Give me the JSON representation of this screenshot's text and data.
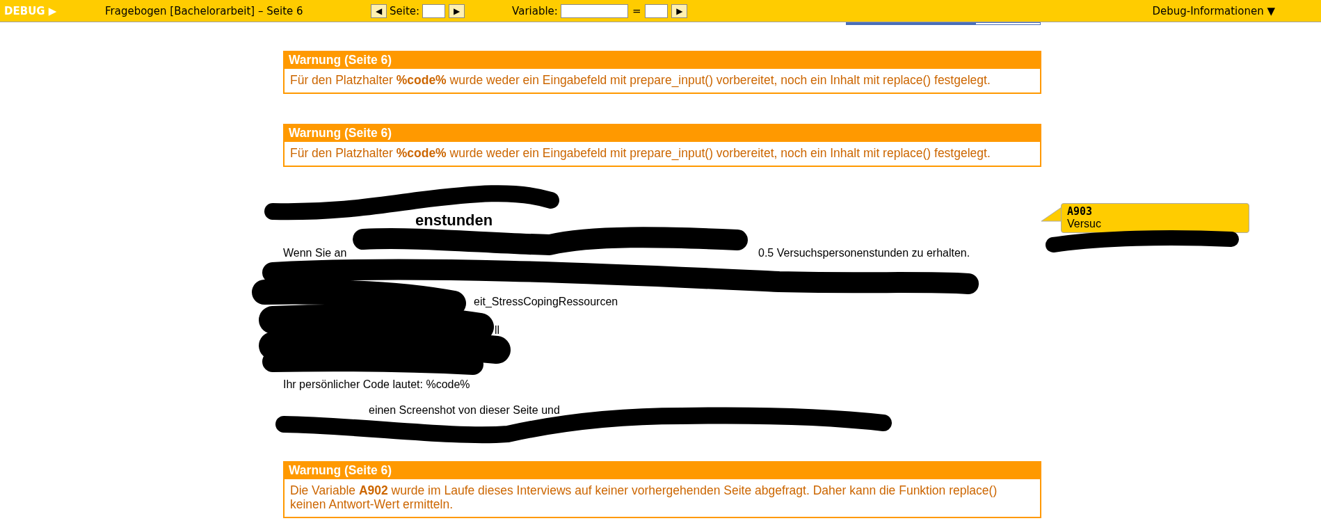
{
  "toolbar": {
    "debug_label": "DEBUG ▶",
    "title": "Fragebogen [Bachelorarbeit] – Seite 6",
    "prev_button": "◀",
    "page_label": "Seite:",
    "next_button": "▶",
    "variable_label": "Variable:",
    "equals": "=",
    "variable_go_button": "▶",
    "info_menu": "Debug-Informationen ▼"
  },
  "progress": {
    "level": 0.67
  },
  "warnings": [
    {
      "title": "Warnung (Seite 6)",
      "message": "Für den Platzhalter **%code%** wurde weder ein Eingabefeld mit prepare_input() vorbereitet, noch ein Inhalt mit replace() festgelegt."
    },
    {
      "title": "Warnung (Seite 6)",
      "message": "Für den Platzhalter **%code%** wurde weder ein Eingabefeld mit prepare_input() vorbereitet, noch ein Inhalt mit replace() festgelegt."
    }
  ],
  "content": {
    "heading": "enstunden",
    "lines": [
      [
        "Wenn Sie an",
        "0.5 Versuchspersonenstunden zu erhalten."
      ],
      [
        "eit_StressCopingRessourcen"
      ],
      [
        "ll"
      ],
      [
        "Ihr persönlicher Code lautet: %code%"
      ],
      [
        "einen Screenshot von dieser Seite und"
      ]
    ]
  },
  "bottom_warning": {
    "title": "Warnung (Seite 6)",
    "message": "Die Variable **A902** wurde im Laufe dieses Interviews auf keiner vorhergehenden Seite abgefragt. Daher kann die Funktion replace() keinen Antwort-Wert ermitteln."
  },
  "tooltip": {
    "variable": "A903",
    "text": "Versuc"
  }
}
